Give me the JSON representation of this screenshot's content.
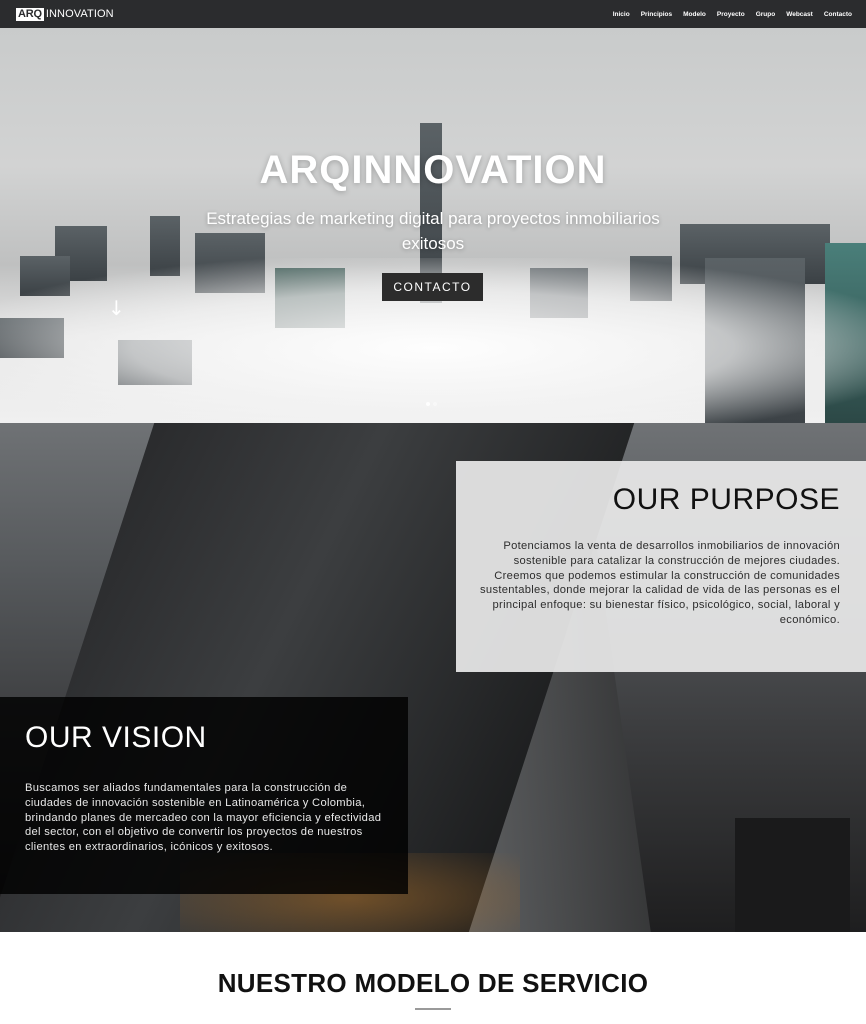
{
  "nav": {
    "logo_box": "ARQ",
    "logo_word": "INNOVATION",
    "items": [
      "Inicio",
      "Principios",
      "Modelo",
      "Proyecto",
      "Grupo",
      "Webcast",
      "Contacto"
    ]
  },
  "hero": {
    "title": "ARQINNOVATION",
    "subtitle": "Estrategias de marketing digital para proyectos inmobiliarios exitosos",
    "cta_label": "CONTACTO",
    "scroll_icon": "arrow-down-icon",
    "slide_count": 2,
    "active_slide": 1
  },
  "purpose": {
    "title": "OUR PURPOSE",
    "text": "Potenciamos la venta de desarrollos inmobiliarios de innovación sostenible para catalizar la construcción de mejores ciudades. Creemos que podemos estimular la construcción de comunidades sustentables, donde mejorar la calidad de vida de las personas es el principal enfoque: su bienestar físico, psicológico, social, laboral y económico."
  },
  "vision": {
    "title": "OUR VISION",
    "text": "Buscamos ser aliados fundamentales para la construcción de ciudades de innovación sostenible en Latinoamérica y Colombia, brindando planes de mercadeo con la mayor eficiencia y efectividad del sector, con el objetivo de convertir los proyectos de nuestros clientes en extraordinarios, icónicos y exitosos."
  },
  "service": {
    "title": "NUESTRO MODELO DE SERVICIO"
  },
  "colors": {
    "nav_bg": "#2b2c2e",
    "cta_bg": "#2c2c2c",
    "purpose_bg": "#e8e8e8",
    "vision_bg": "#000000"
  }
}
